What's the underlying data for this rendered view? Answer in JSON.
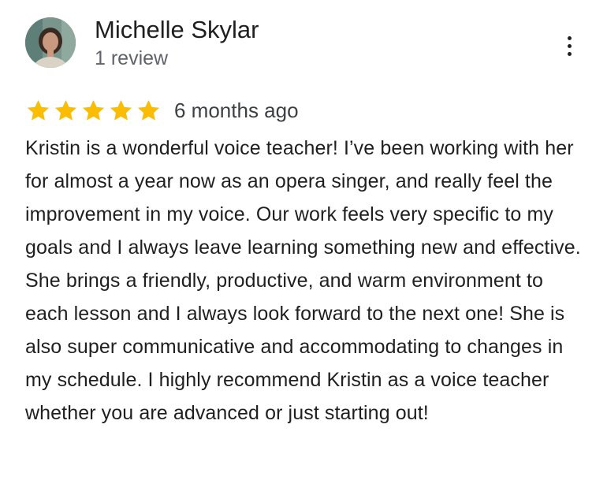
{
  "reviewer": {
    "name": "Michelle Skylar",
    "review_count": "1 review",
    "avatar": "reviewer-photo"
  },
  "menu": {
    "icon": "more-vertical-icon"
  },
  "rating": {
    "stars": 5,
    "max_stars": 5,
    "star_color": "#fbbc04",
    "date": "6 months ago"
  },
  "review": {
    "text": "Kristin is a wonderful voice teacher! I’ve been working with her for almost a year now as an opera singer, and really feel the improvement in my voice. Our work feels very specific to my goals and I always leave learning something new and effective. She brings a friendly, productive, and warm environment to each lesson and I always look forward to the next one! She is also super communicative and accommodating to changes in my schedule. I highly recommend Kristin as a voice teacher whether you are advanced or just starting out!"
  }
}
